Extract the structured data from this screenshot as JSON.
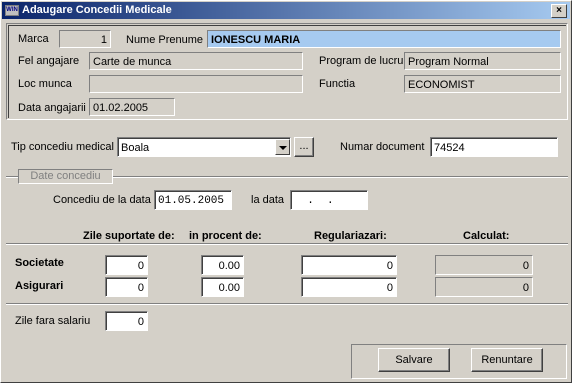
{
  "window": {
    "title": "Adaugare Concedii Medicale",
    "icon_text": "WIN",
    "close_label": "×"
  },
  "employee": {
    "marca_label": "Marca",
    "marca_value": "1",
    "nume_label": "Nume Prenume",
    "nume_value": "IONESCU MARIA",
    "fel_label": "Fel angajare",
    "fel_value": "Carte de munca",
    "program_label": "Program de lucru",
    "program_value": "Program Normal",
    "loc_label": "Loc munca",
    "loc_value": "",
    "functia_label": "Functia",
    "functia_value": "ECONOMIST",
    "data_ang_label": "Data angajarii",
    "data_ang_value": "01.02.2005"
  },
  "leave": {
    "tip_label": "Tip concediu medical",
    "tip_value": "Boala",
    "ellipsis_label": "...",
    "nr_doc_label": "Numar document",
    "nr_doc_value": "74524",
    "group_caption": "Date concediu",
    "from_label": "Concediu de la data",
    "from_value": "01.05.2005",
    "to_label": "la data",
    "to_value": "  .  ."
  },
  "grid": {
    "col_zile": "Zile suportate de:",
    "col_procent": "in procent de:",
    "col_regul": "Regulariazari:",
    "col_calculat": "Calculat:",
    "rows": [
      {
        "label": "Societate",
        "zile": "0",
        "procent": "0.00",
        "regul": "0",
        "calculat": "0"
      },
      {
        "label": "Asigurari",
        "zile": "0",
        "procent": "0.00",
        "regul": "0",
        "calculat": "0"
      }
    ],
    "fara_label": "Zile fara salariu",
    "fara_value": "0"
  },
  "buttons": {
    "save": "Salvare",
    "cancel": "Renuntare"
  }
}
